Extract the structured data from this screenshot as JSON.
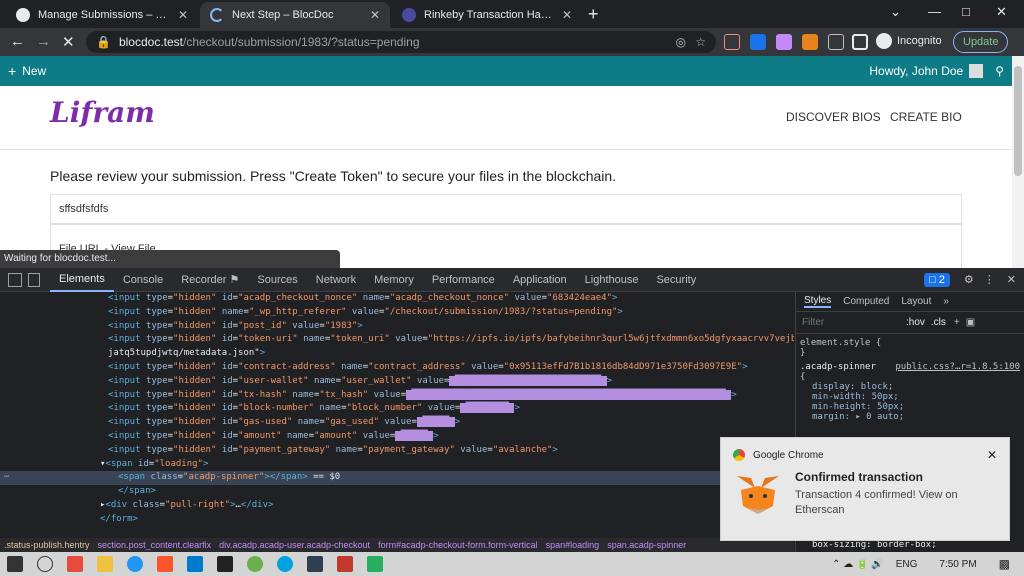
{
  "tabs": [
    {
      "title": "Manage Submissions – BlocDoc",
      "close": "✕",
      "favicon_color": "#e8eaed"
    },
    {
      "title": "Next Step – BlocDoc",
      "close": "✕",
      "favicon_color": "#8ab4f8"
    },
    {
      "title": "Rinkeby Transaction Hash (Txhash",
      "close": "✕",
      "favicon_color": "#4a4aa0"
    }
  ],
  "new_tab": "+",
  "window_controls": {
    "min": "—",
    "max": "□",
    "close": "✕",
    "chevron": "⌄"
  },
  "omnibox": {
    "host": "blocdoc.test",
    "path": "/checkout/submission/1983/?status=pending"
  },
  "incognito_label": "Incognito",
  "update_label": "Update",
  "wp_admin_bar": {
    "new_label": "New",
    "greeting": "Howdy, John Doe"
  },
  "site": {
    "logo": "Lifram",
    "nav": [
      "DISCOVER BIOS",
      "CREATE BIO"
    ],
    "review_text": "Please review your submission. Press \"Create Token\" to secure your files in the blockchain.",
    "field_value": "sffsdfsfdfs",
    "file_url_label": "File URL - View File"
  },
  "status_bubble": "Waiting for blocdoc.test...",
  "devtools": {
    "tabs": [
      "Elements",
      "Console",
      "Recorder ⚑",
      "Sources",
      "Network",
      "Memory",
      "Performance",
      "Application",
      "Lighthouse",
      "Security"
    ],
    "issues_count": "2",
    "styles_tabs": [
      "Styles",
      "Computed",
      "Layout",
      "»"
    ],
    "filter_placeholder": "Filter",
    "hov": ":hov",
    "cls": ".cls",
    "element_style": "element.style {",
    "close_brace": "}",
    "rule_selector": ".acadp-spinner",
    "rule_source": "public.css?…r=1.8.5:100",
    "open_brace": "{",
    "props": [
      "display: block;",
      "min-width: 50px;",
      "min-height: 50px;",
      "margin: ▸ 0 auto;"
    ],
    "box_sizing": "box-sizing: border-box;",
    "breadcrumbs": [
      ".status-publish.hentry",
      "section.post_content.clearfix",
      "div.acadp.acadp-user.acadp-checkout",
      "form#acadp-checkout-form.form-vertical",
      "span#loading",
      "span.acadp-spinner"
    ],
    "lines": [
      {
        "indent": 108,
        "html": "<input type=\"hidden\" id=\"acadp_checkout_nonce\" name=\"acadp_checkout_nonce\" value=\"683424eae4\">"
      },
      {
        "indent": 108,
        "html": "<input type=\"hidden\" name=\"_wp_http_referer\" value=\"/checkout/submission/1983/?status=pending\">"
      },
      {
        "indent": 108,
        "html": "<input type=\"hidden\" id=\"post_id\" value=\"1983\">"
      },
      {
        "indent": 108,
        "html": "<input type=\"hidden\" id=\"token-uri\" name=\"token_uri\" value=\"https://ipfs.io/ipfs/bafybeihnr3qurl5w6jtfxdmmn6xo5dgfyxaacrvv7vejb"
      },
      {
        "indent": 108,
        "html": "jatq5tupdjwtq/metadata.json\">"
      },
      {
        "indent": 108,
        "html": "<input type=\"hidden\" id=\"contract-address\" name=\"contract_address\" value=\"0x95113efFd7B1b1816db84dD971e3750Fd3097E9E\">"
      },
      {
        "indent": 108,
        "html": "<input type=\"hidden\" id=\"user-wallet\" name=\"user_wallet\" value=\"███████████████████████████\">"
      },
      {
        "indent": 108,
        "html": "<input type=\"hidden\" id=\"tx-hash\" name=\"tx_hash\" value=\"██████████████████████████████████████████████████████████\">"
      },
      {
        "indent": 108,
        "html": "<input type=\"hidden\" id=\"block-number\" name=\"block_number\" value=\"████████\">"
      },
      {
        "indent": 108,
        "html": "<input type=\"hidden\" id=\"gas-used\" name=\"gas_used\" value=\"█████\">"
      },
      {
        "indent": 108,
        "html": "<input type=\"hidden\" id=\"amount\" name=\"amount\" value=\"█████\">"
      },
      {
        "indent": 108,
        "html": "<input type=\"hidden\" id=\"payment_gateway\" name=\"payment_gateway\" value=\"avalanche\">"
      },
      {
        "indent": 100,
        "html": "▾<span id=\"loading\">"
      },
      {
        "indent": 118,
        "html": "<span class=\"acadp-spinner\"></span> == $0"
      },
      {
        "indent": 118,
        "html": "</span>"
      },
      {
        "indent": 100,
        "html": "▸<div class=\"pull-right\">…</div>"
      },
      {
        "indent": 100,
        "html": "</form>"
      }
    ]
  },
  "notification": {
    "app": "Google Chrome",
    "title": "Confirmed transaction",
    "body": "Transaction 4 confirmed! View on Etherscan"
  },
  "taskbar": {
    "lang": "ENG",
    "time": "7:50 PM"
  },
  "colors": {
    "accent": "#0e7c86",
    "logo": "#7b2ea8",
    "highlight": "#b48fe0"
  }
}
